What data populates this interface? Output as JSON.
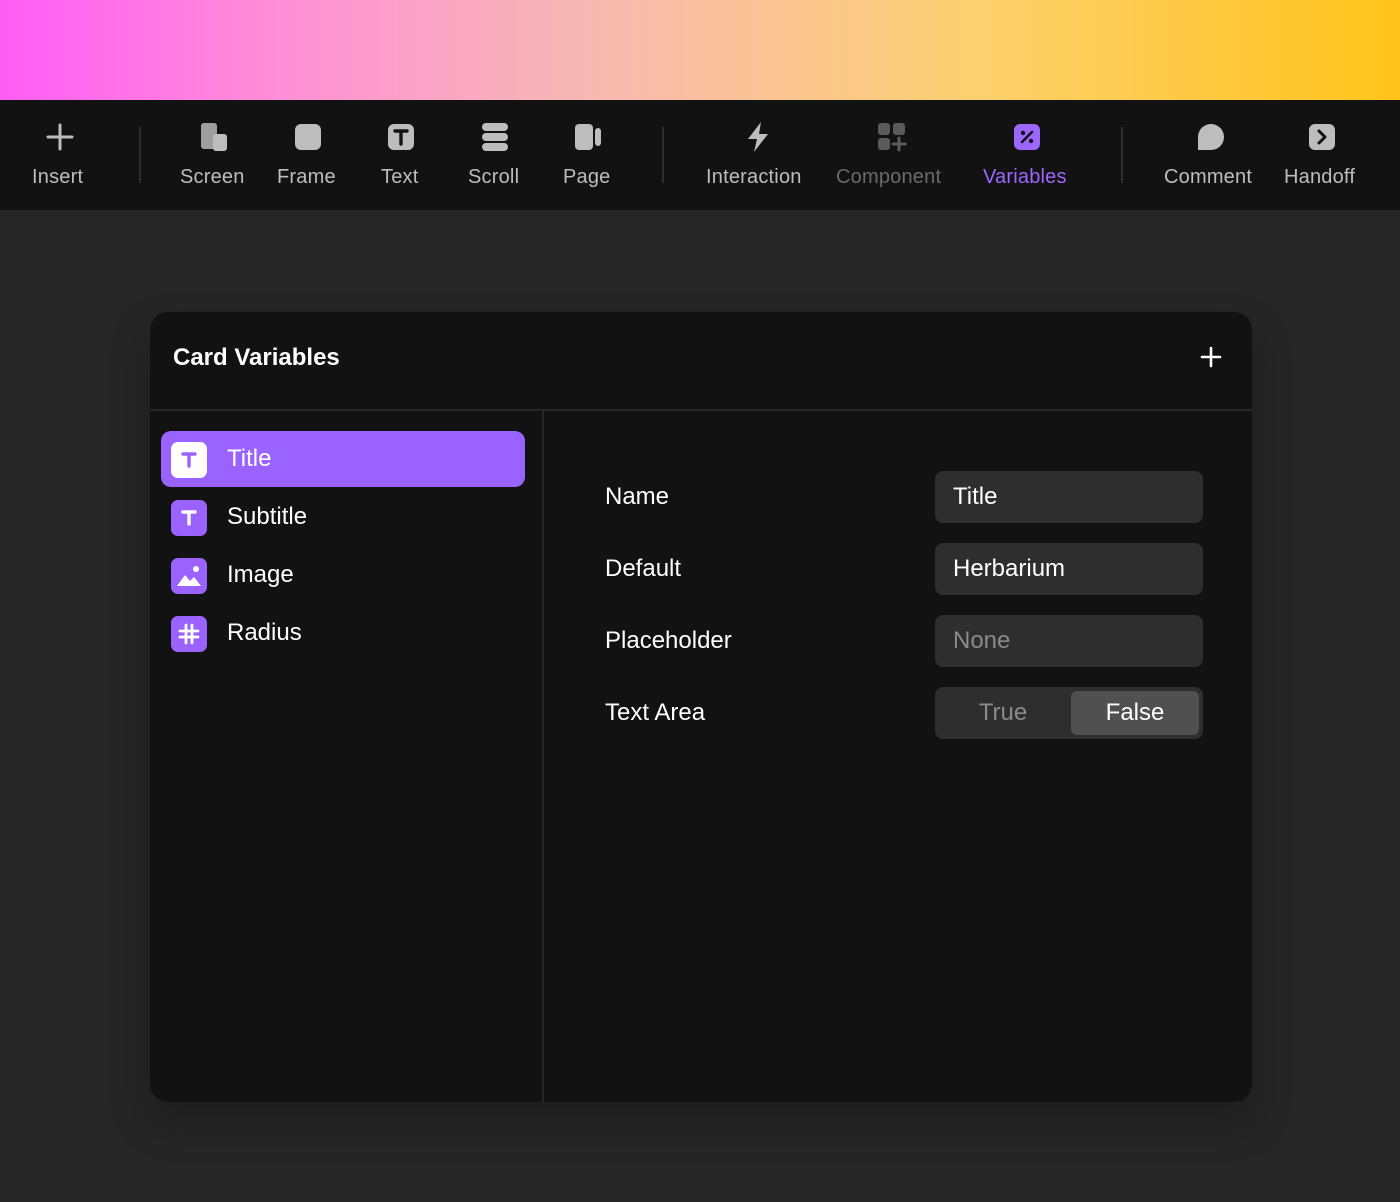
{
  "toolbar": {
    "items": [
      {
        "label": "Insert",
        "icon": "plus-icon"
      },
      {
        "label": "Screen",
        "icon": "screen-icon"
      },
      {
        "label": "Frame",
        "icon": "frame-icon"
      },
      {
        "label": "Text",
        "icon": "text-icon"
      },
      {
        "label": "Scroll",
        "icon": "scroll-icon"
      },
      {
        "label": "Page",
        "icon": "page-icon"
      },
      {
        "label": "Interaction",
        "icon": "lightning-icon"
      },
      {
        "label": "Component",
        "icon": "component-icon",
        "state": "disabled"
      },
      {
        "label": "Variables",
        "icon": "variables-icon",
        "state": "active"
      },
      {
        "label": "Comment",
        "icon": "comment-icon"
      },
      {
        "label": "Handoff",
        "icon": "handoff-icon"
      }
    ],
    "active_color": "#9d66ff"
  },
  "panel": {
    "title": "Card Variables",
    "add_icon": "plus-icon",
    "variables": [
      {
        "label": "Title",
        "icon": "text-type-icon",
        "selected": true
      },
      {
        "label": "Subtitle",
        "icon": "text-type-icon"
      },
      {
        "label": "Image",
        "icon": "image-type-icon"
      },
      {
        "label": "Radius",
        "icon": "number-type-icon"
      }
    ],
    "properties": {
      "name_label": "Name",
      "name_value": "Title",
      "default_label": "Default",
      "default_value": "Herbarium",
      "placeholder_label": "Placeholder",
      "placeholder_placeholder": "None",
      "text_area_label": "Text Area",
      "text_area_options": [
        "True",
        "False"
      ],
      "text_area_selected": "False"
    }
  },
  "colors": {
    "accent": "#9a63ff",
    "panel_bg": "#121212",
    "page_bg": "#262626"
  }
}
